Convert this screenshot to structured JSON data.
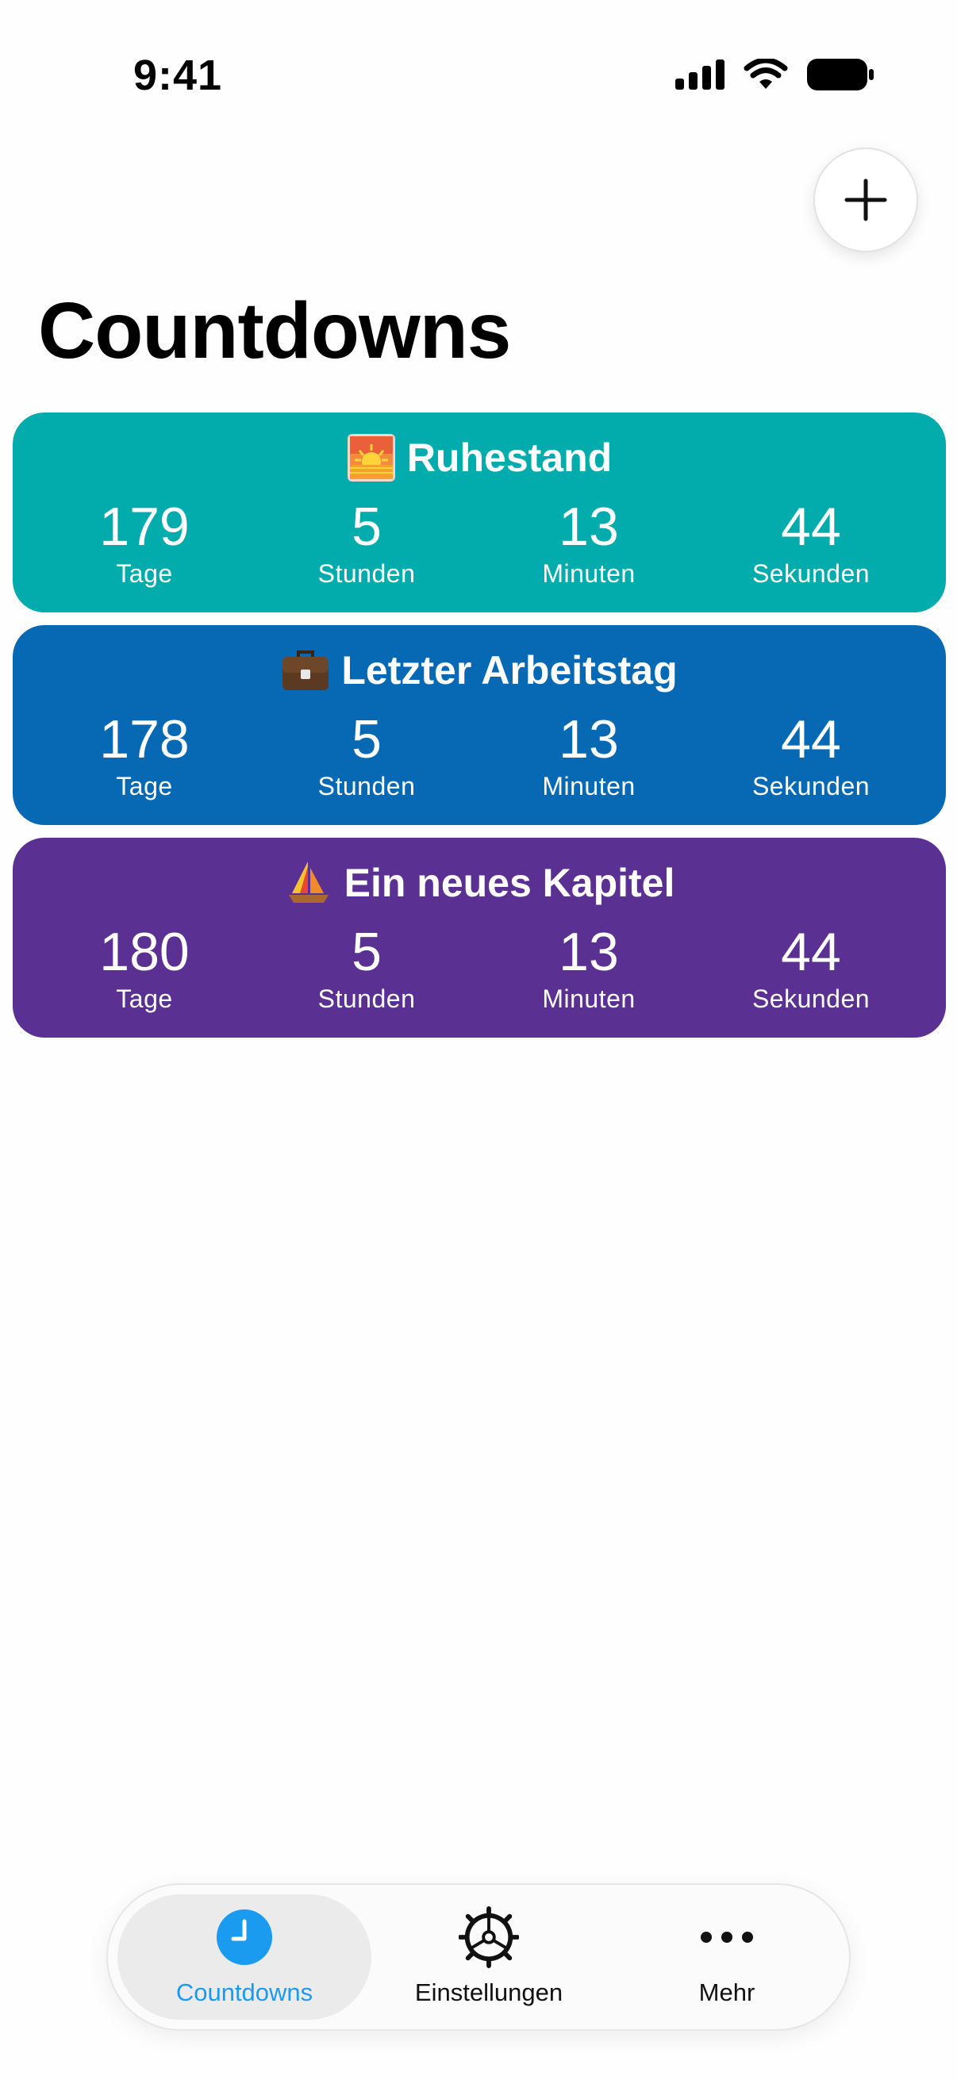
{
  "status_bar": {
    "time": "9:41",
    "icons": [
      "cellular-signal-icon",
      "wifi-icon",
      "battery-icon"
    ]
  },
  "header": {
    "add_icon": "plus-icon",
    "title": "Countdowns"
  },
  "countdowns": [
    {
      "emoji": "sunrise-emoji",
      "title": "Ruhestand",
      "color": "#03ACAC",
      "days": "179",
      "hours": "5",
      "minutes": "13",
      "seconds": "44"
    },
    {
      "emoji": "briefcase-emoji",
      "title": "Letzter Arbeitstag",
      "color": "#0768B4",
      "days": "178",
      "hours": "5",
      "minutes": "13",
      "seconds": "44"
    },
    {
      "emoji": "sailboat-emoji",
      "title": "Ein neues Kapitel",
      "color": "#5A3093",
      "days": "180",
      "hours": "5",
      "minutes": "13",
      "seconds": "44"
    }
  ],
  "unit_labels": {
    "days": "Tage",
    "hours": "Stunden",
    "minutes": "Minuten",
    "seconds": "Sekunden"
  },
  "tab_bar": {
    "active_color": "#1A9BF0",
    "items": [
      {
        "label": "Countdowns",
        "icon": "clock-icon",
        "active": true
      },
      {
        "label": "Einstellungen",
        "icon": "gear-icon",
        "active": false
      },
      {
        "label": "Mehr",
        "icon": "more-dots-icon",
        "active": false
      }
    ]
  }
}
